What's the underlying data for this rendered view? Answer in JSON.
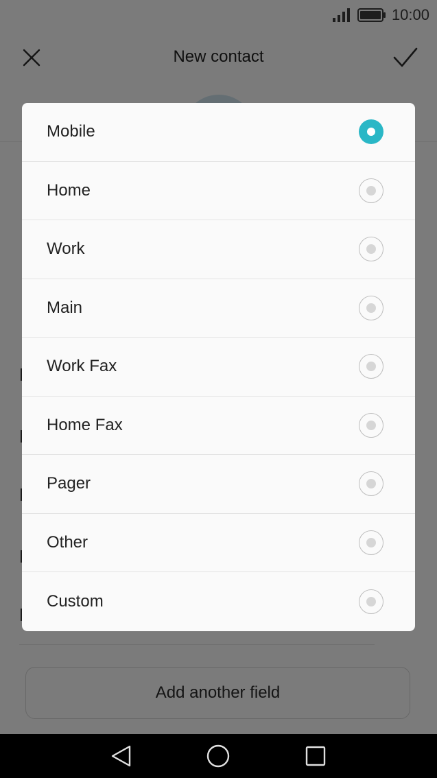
{
  "status_bar": {
    "time": "10:00",
    "signal_icon": "signal-icon",
    "battery_icon": "battery-icon"
  },
  "header": {
    "title": "New contact",
    "close_icon": "close-icon",
    "confirm_icon": "check-icon"
  },
  "background": {
    "add_field_label": "Add another field"
  },
  "dialog": {
    "selected": "Mobile",
    "options": [
      {
        "label": "Mobile",
        "selected": true
      },
      {
        "label": "Home",
        "selected": false
      },
      {
        "label": "Work",
        "selected": false
      },
      {
        "label": "Main",
        "selected": false
      },
      {
        "label": "Work Fax",
        "selected": false
      },
      {
        "label": "Home Fax",
        "selected": false
      },
      {
        "label": "Pager",
        "selected": false
      },
      {
        "label": "Other",
        "selected": false
      },
      {
        "label": "Custom",
        "selected": false
      }
    ]
  },
  "nav_bar": {
    "back_icon": "back-icon",
    "home_icon": "home-icon",
    "recents_icon": "recents-icon"
  },
  "colors": {
    "accent": "#2ab7c6",
    "scrim": "#000000"
  }
}
